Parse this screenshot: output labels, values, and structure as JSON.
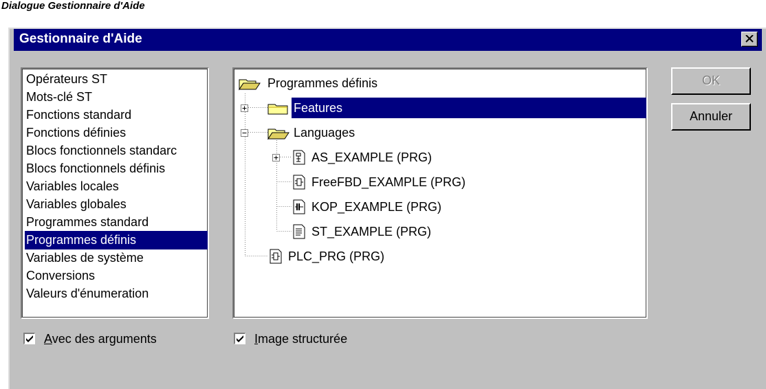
{
  "caption": "Dialogue Gestionnaire d'Aide",
  "dialog": {
    "title": "Gestionnaire d'Aide",
    "close_label": "X"
  },
  "categories": [
    {
      "label": "Opérateurs ST",
      "selected": false
    },
    {
      "label": "Mots-clé ST",
      "selected": false
    },
    {
      "label": "Fonctions standard",
      "selected": false
    },
    {
      "label": "Fonctions définies",
      "selected": false
    },
    {
      "label": "Blocs fonctionnels standarc",
      "selected": false
    },
    {
      "label": "Blocs fonctionnels définis",
      "selected": false
    },
    {
      "label": "Variables locales",
      "selected": false
    },
    {
      "label": "Variables globales",
      "selected": false
    },
    {
      "label": "Programmes standard",
      "selected": false
    },
    {
      "label": "Programmes définis",
      "selected": true
    },
    {
      "label": "Variables de système",
      "selected": false
    },
    {
      "label": "Conversions",
      "selected": false
    },
    {
      "label": "Valeurs d'énumeration",
      "selected": false
    }
  ],
  "tree": {
    "root": "Programmes définis",
    "features": "Features",
    "languages": "Languages",
    "as_example": "AS_EXAMPLE (PRG)",
    "freefbd_example": "FreeFBD_EXAMPLE (PRG)",
    "kop_example": "KOP_EXAMPLE (PRG)",
    "st_example": "ST_EXAMPLE (PRG)",
    "plc_prg": "PLC_PRG (PRG)"
  },
  "buttons": {
    "ok": "OK",
    "cancel": "Annuler"
  },
  "checkboxes": {
    "with_arguments": {
      "first": "A",
      "rest": "vec des arguments",
      "checked": true
    },
    "structured_image": {
      "first": "I",
      "rest": "mage structurée",
      "checked": true
    }
  }
}
